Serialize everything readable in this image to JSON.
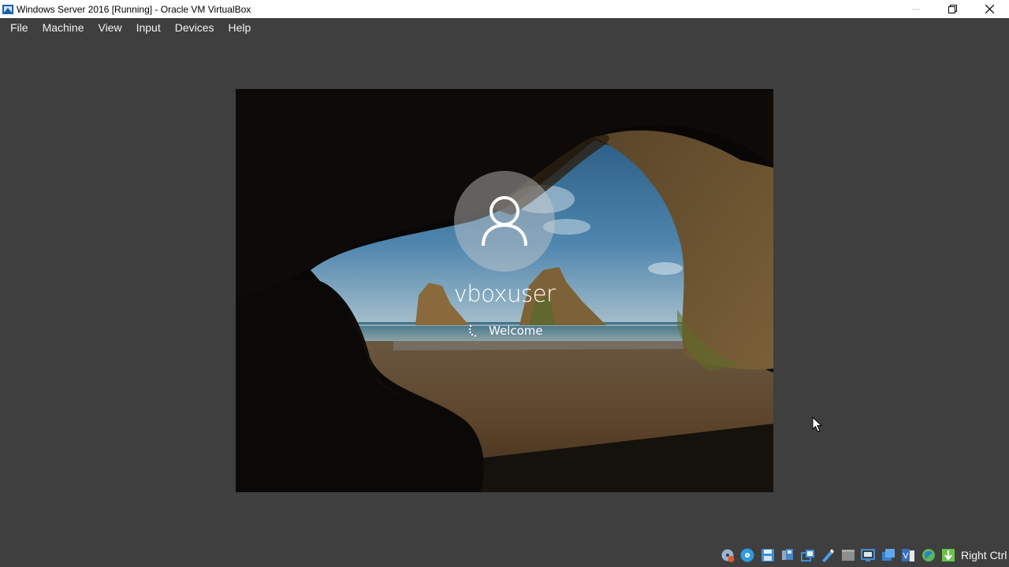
{
  "window": {
    "title": "Windows Server 2016 [Running] - Oracle VM VirtualBox",
    "icon": "virtualbox-icon",
    "controls": [
      "minimize-icon",
      "restore-icon",
      "close-icon"
    ]
  },
  "menu": {
    "items": [
      {
        "label": "File"
      },
      {
        "label": "Machine"
      },
      {
        "label": "View"
      },
      {
        "label": "Input"
      },
      {
        "label": "Devices"
      },
      {
        "label": "Help"
      }
    ]
  },
  "vm": {
    "username": "vboxuser",
    "status": "Welcome",
    "avatar_icon": "user-icon",
    "spinner_icon": "loading-spinner-icon"
  },
  "statusbar": {
    "icons": [
      "hard-disk-icon",
      "optical-drive-icon",
      "floppy-icon",
      "audio-icon",
      "network-icon",
      "usb-icon",
      "shared-folders-icon",
      "display-icon",
      "recording-icon",
      "cpu-icon",
      "mouse-integration-icon",
      "keyboard-icon"
    ],
    "host_key": "Right Ctrl"
  },
  "colors": {
    "background": "#3f3f3f",
    "titlebar": "#ffffff",
    "menu_text": "#f2f2f2"
  }
}
